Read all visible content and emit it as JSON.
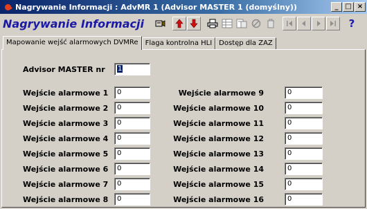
{
  "window": {
    "title": "Nagrywanie Informacji : AdvMR 1 (Advisor MASTER 1 (domyślny))",
    "controls": [
      "_",
      "□",
      "×"
    ]
  },
  "toolbar": {
    "heading": "Nagrywanie Informacji",
    "buttons": [
      "record-icon",
      "arrow-up-icon",
      "arrow-down-icon",
      "print-icon",
      "grid-icon",
      "export-icon",
      "cancel-icon",
      "trash-icon",
      "first-icon",
      "prev-icon",
      "next-icon",
      "last-icon",
      "help-icon"
    ],
    "help_label": "?"
  },
  "tabs": [
    "Mapowanie wejść alarmowych DVMRe",
    "Flaga kontrolna HLI",
    "Dostęp dla ZAZ"
  ],
  "form": {
    "master_label": "Advisor MASTER nr",
    "master_value": "1",
    "inputs_left": [
      {
        "label": "Wejście alarmowe 1",
        "value": "0"
      },
      {
        "label": "Wejście alarmowe 2",
        "value": "0"
      },
      {
        "label": "Wejście alarmowe 3",
        "value": "0"
      },
      {
        "label": "Wejście alarmowe 4",
        "value": "0"
      },
      {
        "label": "Wejście alarmowe 5",
        "value": "0"
      },
      {
        "label": "Wejście alarmowe 6",
        "value": "0"
      },
      {
        "label": "Wejście alarmowe 7",
        "value": "0"
      },
      {
        "label": "Wejście alarmowe 8",
        "value": "0"
      }
    ],
    "inputs_right": [
      {
        "label": "Wejście alarmowe 9",
        "value": "0"
      },
      {
        "label": "Wejście alarmowe 10",
        "value": "0"
      },
      {
        "label": "Wejście alarmowe 11",
        "value": "0"
      },
      {
        "label": "Wejście alarmowe 12",
        "value": "0"
      },
      {
        "label": "Wejście alarmowe 13",
        "value": "0"
      },
      {
        "label": "Wejście alarmowe 14",
        "value": "0"
      },
      {
        "label": "Wejście alarmowe 15",
        "value": "0"
      },
      {
        "label": "Wejście alarmowe 16",
        "value": "0"
      }
    ]
  }
}
